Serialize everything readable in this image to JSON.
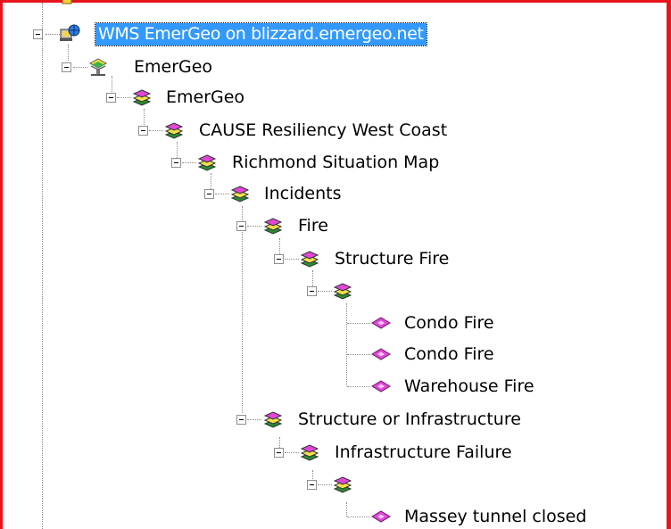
{
  "tree": {
    "server": {
      "label": "WMS EmerGeo on blizzard.emergeo.net",
      "selected": true,
      "icon": "wms-server-icon"
    },
    "n1": {
      "label": "EmerGeo",
      "icon": "layer-group-icon"
    },
    "n2": {
      "label": "EmerGeo",
      "icon": "layer-stack-icon"
    },
    "n3": {
      "label": "CAUSE Resiliency West Coast",
      "icon": "layer-stack-icon"
    },
    "n4": {
      "label": "Richmond Situation Map",
      "icon": "layer-stack-icon"
    },
    "n5": {
      "label": "Incidents",
      "icon": "layer-stack-icon"
    },
    "n6": {
      "label": "Fire",
      "icon": "layer-stack-icon"
    },
    "n7": {
      "label": "Structure Fire",
      "icon": "layer-stack-icon"
    },
    "n8": {
      "label": "",
      "icon": "layer-stack-icon"
    },
    "leaf1": {
      "label": "Condo Fire",
      "icon": "layer-diamond-icon"
    },
    "leaf2": {
      "label": "Condo Fire",
      "icon": "layer-diamond-icon"
    },
    "leaf3": {
      "label": "Warehouse Fire",
      "icon": "layer-diamond-icon"
    },
    "n9": {
      "label": "Structure or Infrastructure",
      "icon": "layer-stack-icon"
    },
    "n10": {
      "label": "Infrastructure Failure",
      "icon": "layer-stack-icon"
    },
    "n11": {
      "label": "",
      "icon": "layer-stack-icon"
    },
    "leaf4": {
      "label": "Massey tunnel closed",
      "icon": "layer-diamond-icon"
    }
  },
  "colors": {
    "frame": "#e8141b",
    "selection": "#3399ff",
    "leaf": "#e046d8"
  }
}
